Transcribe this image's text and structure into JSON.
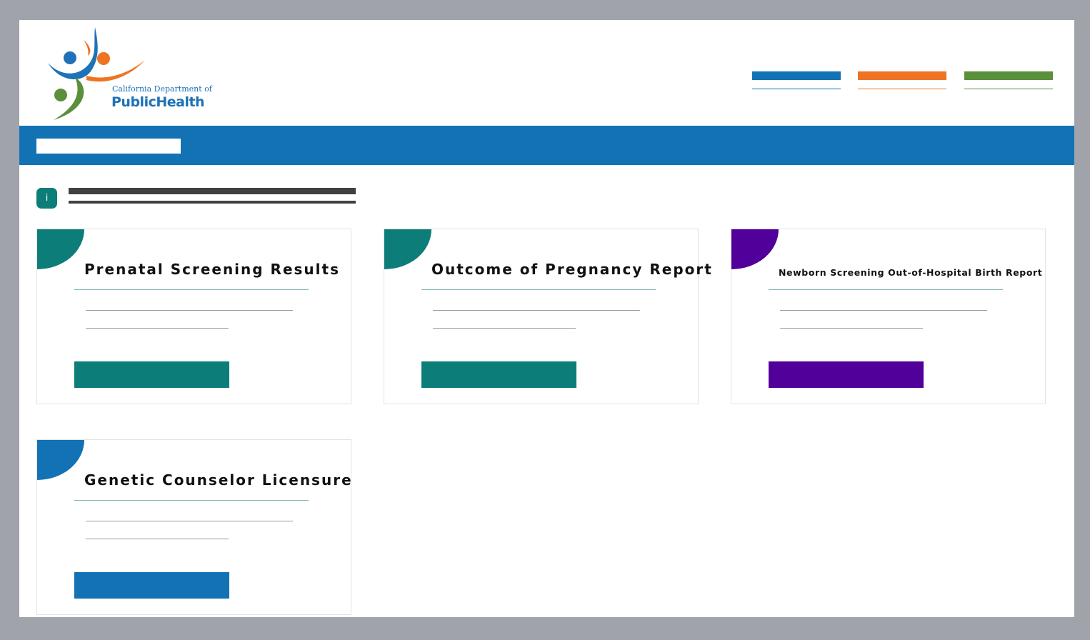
{
  "header": {
    "logo_line1": "California Department of",
    "logo_line2": "PublicHealth"
  },
  "nav": {
    "links": [
      {
        "color": "#1272b4"
      },
      {
        "color": "#ee7424"
      },
      {
        "color": "#5a8f3c"
      }
    ]
  },
  "colors": {
    "banner": "#1272b4",
    "teal": "#0c7d78",
    "purple": "#510099",
    "blue": "#1272b4",
    "notice_text": "#404040"
  },
  "notice": {
    "icon": "info-icon",
    "icon_glyph": "i"
  },
  "cards": [
    {
      "title": "Prenatal Screening  Results",
      "accent": "#0c7d78"
    },
    {
      "title": "Outcome of Pregnancy Report",
      "accent": "#0c7d78"
    },
    {
      "title": "Newborn Screening Out-of-Hospital Birth Report",
      "accent": "#510099"
    },
    {
      "title": "Genetic Counselor Licensure",
      "accent": "#1272b4"
    }
  ]
}
